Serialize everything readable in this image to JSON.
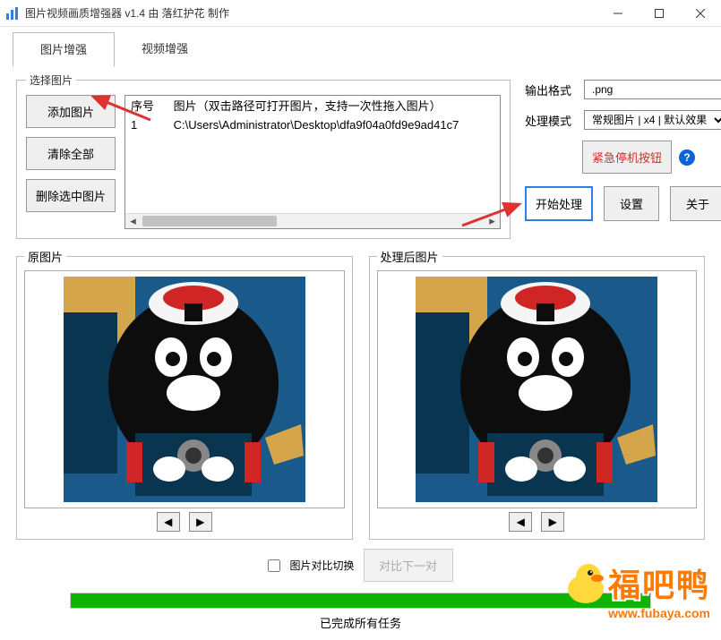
{
  "title": "图片视频画质增强器 v1.4    由 落红护花 制作",
  "tabs": {
    "image": "图片增强",
    "video": "视频增强"
  },
  "select_group": {
    "legend": "选择图片",
    "add_btn": "添加图片",
    "clear_btn": "清除全部",
    "delete_btn": "删除选中图片",
    "list_header_col1": "序号",
    "list_header_col2": "图片（双击路径可打开图片，支持一次性拖入图片）",
    "row_num": "1",
    "row_path": "C:\\Users\\Administrator\\Desktop\\dfa9f04a0fd9e9ad41c7"
  },
  "options": {
    "format_label": "输出格式",
    "format_value": ".png",
    "mode_label": "处理模式",
    "mode_value": "常规图片 | x4 | 默认效果",
    "stop_btn": "紧急停机按钮"
  },
  "actions": {
    "start": "开始处理",
    "settings": "设置",
    "about": "关于"
  },
  "preview": {
    "original": "原图片",
    "processed": "处理后图片"
  },
  "compare": {
    "label": "图片对比切换",
    "next_btn": "对比下一对"
  },
  "status": "已完成所有任务",
  "watermark": {
    "text": "福吧鸭",
    "url": "www.fubaya.com"
  }
}
